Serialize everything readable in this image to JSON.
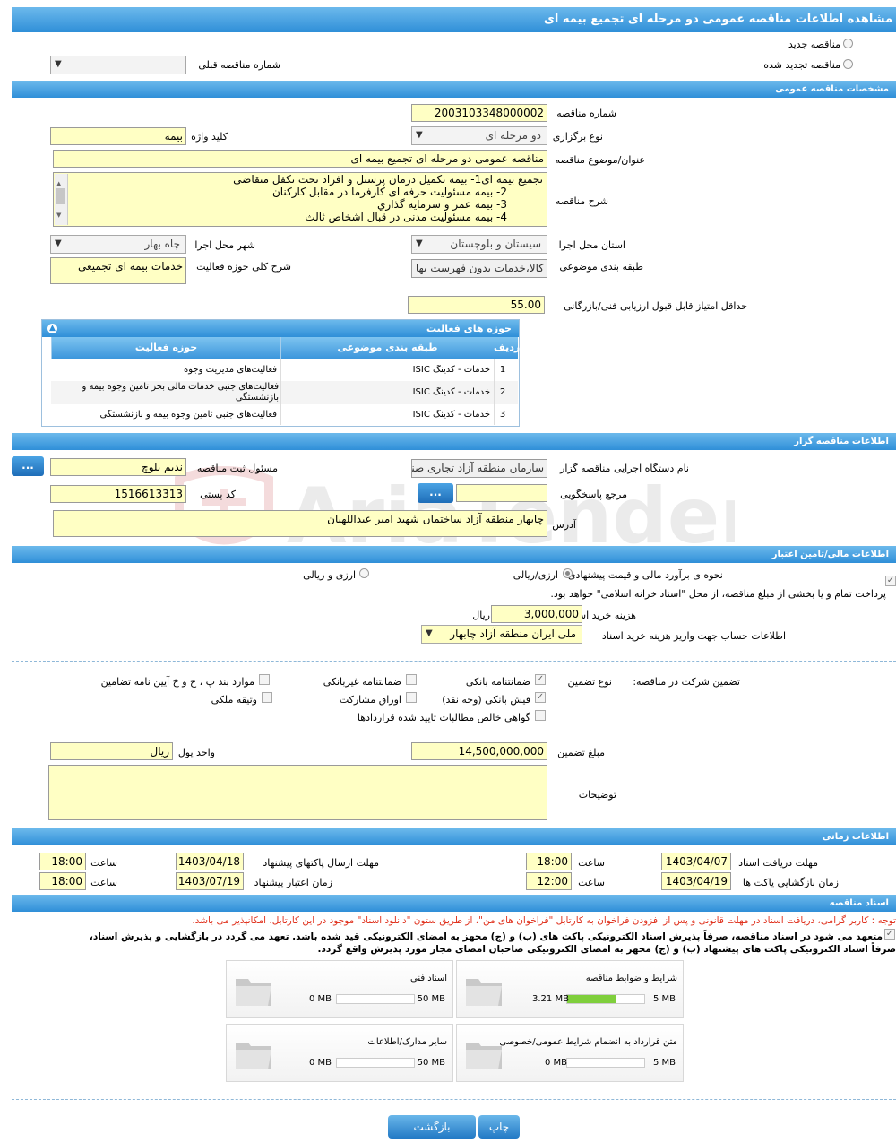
{
  "page": {
    "title": "مشاهده اطلاعات مناقصه عمومی دو مرحله ای تجمیع بیمه ای"
  },
  "top": {
    "radio_new": "مناقصه جدید",
    "radio_renewed": "مناقصه تجدید شده",
    "prev_tender_label": "شماره مناقصه قبلی",
    "prev_tender_value": "--"
  },
  "general": {
    "section_title": "مشخصات مناقصه عمومی",
    "tender_no_label": "شماره مناقصه",
    "tender_no": "2003103348000002",
    "type_label": "نوع برگزاری",
    "type_value": "دو مرحله ای",
    "keyword_label": "کلید واژه",
    "keyword_value": "بیمه",
    "subject_label": "عنوان/موضوع مناقصه",
    "subject_value": "مناقصه عمومی دو مرحله ای تجمیع بیمه ای",
    "desc_label": "شرح مناقصه",
    "desc_lines": [
      "تجمیع بیمه ای1-  بیمه تکمیل درمان پرسنل و افراد تحت تکفل متقاضی",
      "2-     بیمه مسئولیت حرفه ای کارفرما در مقابل کارکنان",
      "3-     بیمه عمر و سرمایه گذاري",
      "4-     بیمه مسئولیت مدنی در قبال اشخاص ثالث"
    ],
    "province_label": "استان محل اجرا",
    "province_value": "سیستان و بلوچستان",
    "city_label": "شهر محل اجرا",
    "city_value": "چاه بهار",
    "category_label": "طبقه بندی موضوعی",
    "category_value": "کالا،خدمات بدون فهرست بها",
    "scope_label": "شرح کلی حوزه فعالیت",
    "scope_value": "خدمات بیمه ای تجمیعی",
    "min_score_label": "حداقل امتیاز قابل قبول ارزیابی فنی/بازرگانی",
    "min_score_value": "55.00"
  },
  "activity_grid": {
    "title": "حوزه های فعالیت",
    "headers": {
      "row": "ردیف",
      "category": "طبقه بندی موضوعی",
      "field": "حوزه فعالیت"
    },
    "rows": [
      {
        "row": "1",
        "category": "خدمات - کدینگ ISIC",
        "field": "فعالیت‌های مدیریت وجوه"
      },
      {
        "row": "2",
        "category": "خدمات - کدینگ ISIC",
        "field": "فعالیت‌های جنبی  خدمات مالی بجز تامین وجوه  بیمه و بازنشستگی"
      },
      {
        "row": "3",
        "category": "خدمات - کدینگ ISIC",
        "field": "فعالیت‌های جنبی تامین وجوه بیمه و بازنشستگی"
      }
    ]
  },
  "organizer": {
    "section_title": "اطلاعات مناقصه گزار",
    "org_label": "نام دستگاه اجرایی مناقصه گزار",
    "org_value": "سازمان منطقه آزاد تجاری صنعتی چابهار",
    "registrar_label": "مسئول ثبت مناقصه",
    "registrar_value": "ندیم بلوچ",
    "ref_label": "مرجع پاسخگویی",
    "ref_value": "",
    "postal_label": "کد پستی",
    "postal_value": "1516613313",
    "address_label": "آدرس",
    "address_value": "چابهار منطقه آزاد  ساختمان شهید امیر عبداللهیان",
    "dots": "..."
  },
  "finance": {
    "section_title": "اطلاعات مالی/تامین اعتبار",
    "estimate_label": "نحوه ی برآورد مالی و قیمت پیشنهادی",
    "opt_rial": "ارزی/ریالی",
    "opt_fx": "ارزی و ریالی",
    "treasury_note": "پرداخت تمام و یا بخشی از مبلغ مناقصه، از محل \"اسناد خزانه اسلامی\" خواهد بود.",
    "doc_fee_label": "هزینه خرید اسناد",
    "doc_fee_value": "3,000,000",
    "doc_fee_unit": "ریال",
    "account_label": "اطلاعات حساب جهت واریز هزینه خرید اسناد",
    "account_value": "ملی ایران منطقه آزاد چابهار"
  },
  "guarantee": {
    "participation_label": "تضمین شرکت در مناقصه:",
    "type_label": "نوع تضمین",
    "bank_guarantee": "ضمانتنامه بانکی",
    "nonbank_guarantee": "ضمانتنامه غیربانکی",
    "regulation_items": "موارد بند پ ، ج و خ آیین نامه تضامین",
    "cash_receipt": "فیش بانکی (وجه نقد)",
    "partnership_bonds": "اوراق مشارکت",
    "property_collateral": "وثیقه ملکی",
    "net_claims": "گواهی خالص مطالبات تایید شده قراردادها",
    "amount_label": "مبلغ تضمین",
    "amount_value": "14,500,000,000",
    "currency_label": "واحد پول",
    "currency_value": "ریال",
    "notes_label": "توضیحات",
    "notes_value": ""
  },
  "timing": {
    "section_title": "اطلاعات زمانی",
    "doc_deadline_label": "مهلت دریافت اسناد",
    "doc_deadline_date": "1403/04/07",
    "doc_deadline_time": "18:00",
    "submit_deadline_label": "مهلت ارسال پاکتهای پیشنهاد",
    "submit_deadline_date": "1403/04/18",
    "submit_deadline_time": "18:00",
    "opening_label": "زمان بازگشایی پاکت ها",
    "opening_date": "1403/04/19",
    "opening_time": "12:00",
    "validity_label": "زمان اعتبار پیشنهاد",
    "validity_date": "1403/07/19",
    "validity_time": "18:00",
    "time_label": "ساعت"
  },
  "documents": {
    "section_title": "اسناد مناقصه",
    "notice": "توجه : کاربر گرامی، دریافت اسناد در مهلت قانونی و پس از افزودن فراخوان به کارتابل \"فراخوان های من\"، از طریق ستون \"دانلود اسناد\" موجود در این کارتابل، امکانپذیر می باشد.",
    "commit_line1": "متعهد می شود در اسناد مناقصه، صرفاً پذیرش اسناد الکترونیکی پاکت های (ب) و (ج) مجهز به امضای الکترونیکی قید شده باشد. تعهد می گردد در بازگشایی و پذیرش اسناد،",
    "commit_line2": "صرفاً اسناد الکترونیکی پاکت های پیشنهاد (ب) و (ج) مجهز به امضای الکترونیکی صاحبان امضای مجاز مورد پذیرش واقع گردد.",
    "tiles": [
      {
        "name": "شرایط و ضوابط مناقصه",
        "current": "3.21 MB",
        "max": "5 MB",
        "percent": 64
      },
      {
        "name": "اسناد فنی",
        "current": "0 MB",
        "max": "50 MB",
        "percent": 0
      },
      {
        "name": "متن قرارداد به انضمام شرایط عمومی/خصوصی",
        "current": "0 MB",
        "max": "5 MB",
        "percent": 0
      },
      {
        "name": "سایر مدارک/اطلاعات",
        "current": "0 MB",
        "max": "50 MB",
        "percent": 0
      }
    ]
  },
  "buttons": {
    "print": "چاپ",
    "back": "بازگشت"
  },
  "watermark": {
    "text": "AriaTender.neT"
  },
  "colors": {
    "header": "#2f8fd8",
    "field": "#ffffc4",
    "progress": "#7fcf3c",
    "notice": "#e0321e"
  }
}
